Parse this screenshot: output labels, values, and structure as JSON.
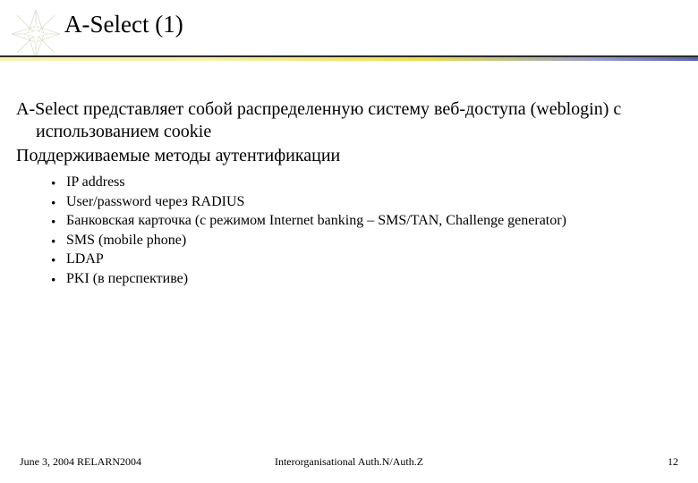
{
  "title": "A-Select (1)",
  "body": {
    "para1": "A-Select представляет собой распределенную систему веб-доступа (weblogin) с использованием cookie",
    "para2": "Поддерживаемые методы аутентификации",
    "bullets": [
      "IP address",
      "User/password через RADIUS",
      "Банковская карточка (с режимом Internet banking – SMS/TAN, Challenge generator)",
      "SMS (mobile phone)",
      "LDAP",
      "PKI (в перспективе)"
    ]
  },
  "footer": {
    "left": "June 3, 2004 RELARN2004",
    "center": "Interorganisational Auth.N/Auth.Z",
    "page": "12"
  }
}
